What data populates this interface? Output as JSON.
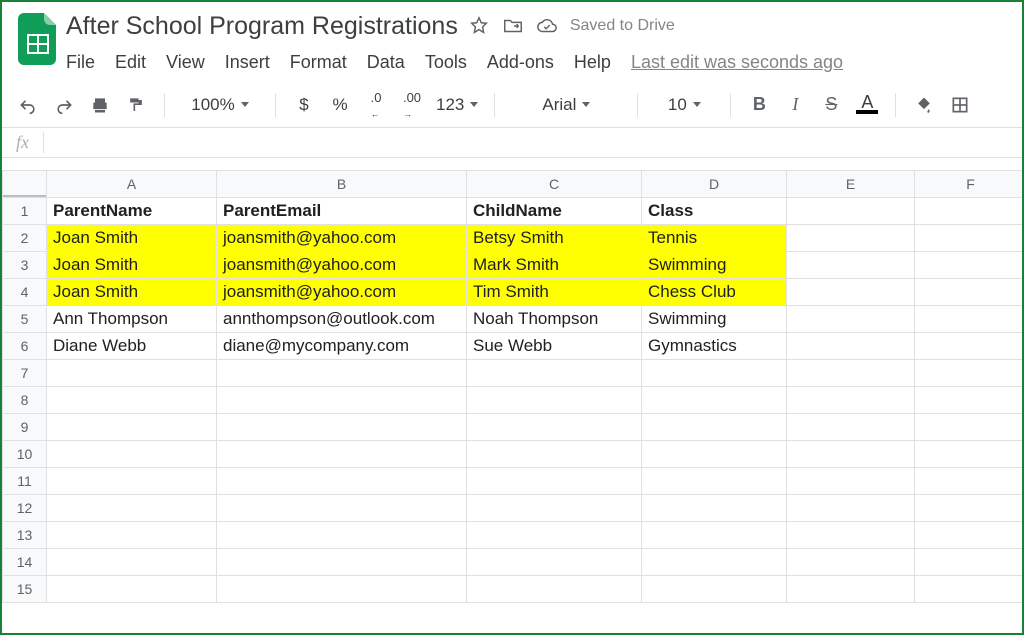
{
  "title": "After School Program Registrations",
  "saved_label": "Saved to Drive",
  "last_edit": "Last edit was seconds ago",
  "menus": {
    "file": "File",
    "edit": "Edit",
    "view": "View",
    "insert": "Insert",
    "format": "Format",
    "data": "Data",
    "tools": "Tools",
    "addons": "Add-ons",
    "help": "Help"
  },
  "toolbar": {
    "zoom": "100%",
    "currency": "$",
    "percent": "%",
    "dec_dec": ".0",
    "dec_inc": ".00",
    "more_fmt": "123",
    "font": "Arial",
    "font_size": "10",
    "bold": "B",
    "italic": "I",
    "strike": "S",
    "textcolor": "A"
  },
  "formula_bar": {
    "label": "fx",
    "value": ""
  },
  "columns": [
    "A",
    "B",
    "C",
    "D",
    "E",
    "F"
  ],
  "headers": {
    "A": "ParentName",
    "B": "ParentEmail",
    "C": "ChildName",
    "D": "Class"
  },
  "rows": [
    {
      "n": 1,
      "header": true
    },
    {
      "n": 2,
      "highlight": true,
      "A": "Joan Smith",
      "B": "joansmith@yahoo.com",
      "C": "Betsy Smith",
      "D": "Tennis"
    },
    {
      "n": 3,
      "highlight": true,
      "A": "Joan Smith",
      "B": "joansmith@yahoo.com",
      "C": "Mark Smith",
      "D": "Swimming"
    },
    {
      "n": 4,
      "highlight": true,
      "A": "Joan Smith",
      "B": "joansmith@yahoo.com",
      "C": "Tim Smith",
      "D": "Chess Club"
    },
    {
      "n": 5,
      "A": "Ann Thompson",
      "B": "annthompson@outlook.com",
      "C": "Noah Thompson",
      "D": "Swimming"
    },
    {
      "n": 6,
      "A": "Diane Webb",
      "B": "diane@mycompany.com",
      "C": "Sue Webb",
      "D": "Gymnastics"
    },
    {
      "n": 7
    },
    {
      "n": 8
    },
    {
      "n": 9
    },
    {
      "n": 10
    },
    {
      "n": 11
    },
    {
      "n": 12
    },
    {
      "n": 13
    },
    {
      "n": 14
    },
    {
      "n": 15
    }
  ]
}
